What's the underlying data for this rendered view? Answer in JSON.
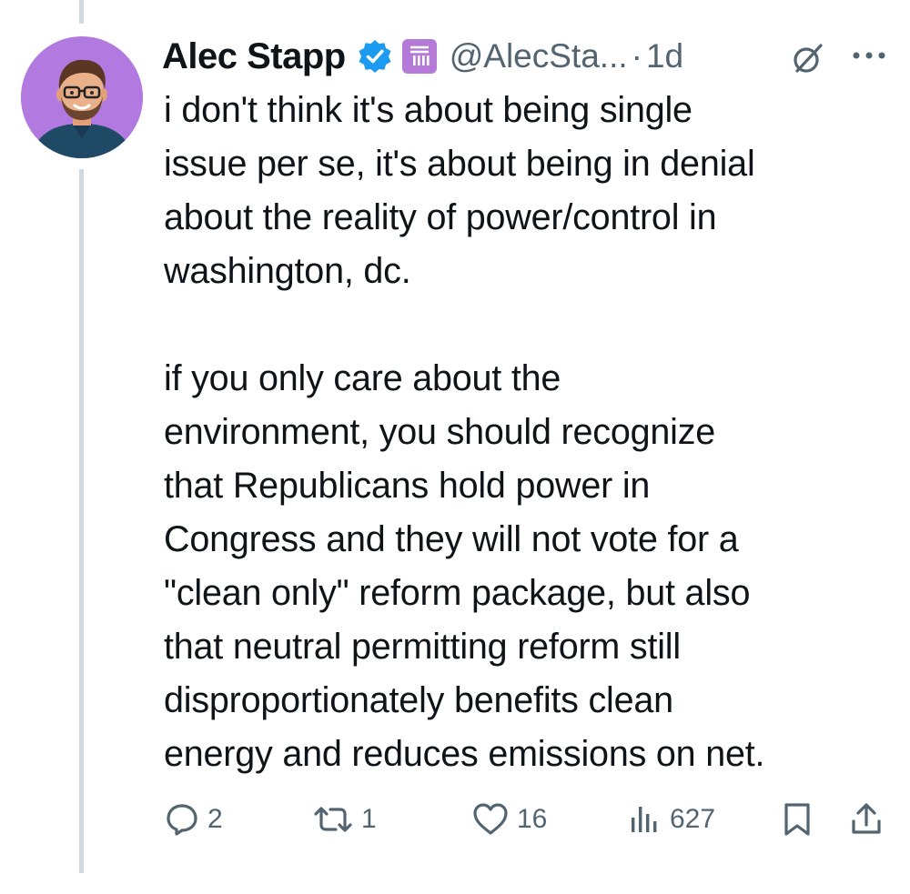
{
  "author": {
    "name": "Alec Stapp",
    "handle": "@AlecSta...",
    "separator": "·",
    "time": "1d"
  },
  "tweet": {
    "text": "i don't think it's about being single\nissue per se, it's about being in denial\nabout the reality of power/control in\nwashington, dc.\n\nif you only care about the\nenvironment, you should recognize\nthat Republicans hold power in\nCongress and they will not vote for a\n\"clean only\" reform package, but also\nthat neutral permitting reform still\ndisproportionately benefits clean\nenergy and reduces emissions on net."
  },
  "actions": {
    "replies": "2",
    "reposts": "1",
    "likes": "16",
    "views": "627"
  },
  "icons": {
    "verified": "verified-badge-icon",
    "affiliation": "organization-badge-icon",
    "grok": "grok-icon",
    "more": "more-icon",
    "reply": "reply-icon",
    "repost": "repost-icon",
    "like": "like-icon",
    "views": "views-icon",
    "bookmark": "bookmark-icon",
    "share": "share-icon"
  },
  "colors": {
    "verified_blue": "#1d9bf0",
    "avatar_background": "#b27ae0",
    "affiliation_badge": "#b57ad8",
    "secondary_text": "#536471",
    "thread_line": "#cfd9de"
  }
}
